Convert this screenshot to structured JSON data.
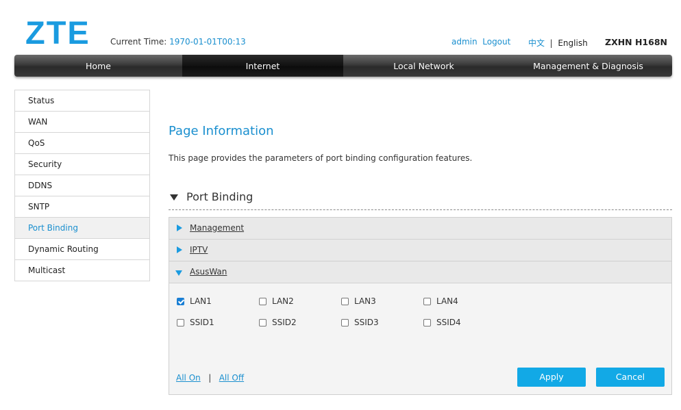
{
  "header": {
    "logo": "ZTE",
    "current_time_label": "Current Time:",
    "current_time_value": "1970-01-01T00:13",
    "user": "admin",
    "logout": "Logout",
    "lang_zh": "中文",
    "lang_sep": "|",
    "lang_en": "English",
    "model": "ZXHN H168N"
  },
  "nav": {
    "items": [
      {
        "label": "Home"
      },
      {
        "label": "Internet"
      },
      {
        "label": "Local Network"
      },
      {
        "label": "Management & Diagnosis"
      }
    ],
    "active": "Internet"
  },
  "sidebar": {
    "items": [
      {
        "label": "Status"
      },
      {
        "label": "WAN"
      },
      {
        "label": "QoS"
      },
      {
        "label": "Security"
      },
      {
        "label": "DDNS"
      },
      {
        "label": "SNTP"
      },
      {
        "label": "Port Binding"
      },
      {
        "label": "Dynamic Routing"
      },
      {
        "label": "Multicast"
      }
    ],
    "active": "Port Binding"
  },
  "main": {
    "page_title": "Page Information",
    "page_description": "This page provides the parameters of port binding configuration features.",
    "section_title": "Port Binding",
    "accordion": [
      {
        "label": "Management",
        "expanded": false
      },
      {
        "label": "IPTV",
        "expanded": false
      },
      {
        "label": "AsusWan",
        "expanded": true
      }
    ],
    "ports": [
      {
        "label": "LAN1",
        "checked": true
      },
      {
        "label": "LAN2",
        "checked": false
      },
      {
        "label": "LAN3",
        "checked": false
      },
      {
        "label": "LAN4",
        "checked": false
      },
      {
        "label": "SSID1",
        "checked": false
      },
      {
        "label": "SSID2",
        "checked": false
      },
      {
        "label": "SSID3",
        "checked": false
      },
      {
        "label": "SSID4",
        "checked": false
      }
    ],
    "all_on": "All On",
    "all_sep": "|",
    "all_off": "All Off",
    "apply": "Apply",
    "cancel": "Cancel"
  },
  "colors": {
    "brand": "#1a9be0",
    "link": "#1a8fcf",
    "button": "#12a9e6",
    "checkbox_checked": "#1a7fd4",
    "nav_dark": "#2a2a2a"
  }
}
